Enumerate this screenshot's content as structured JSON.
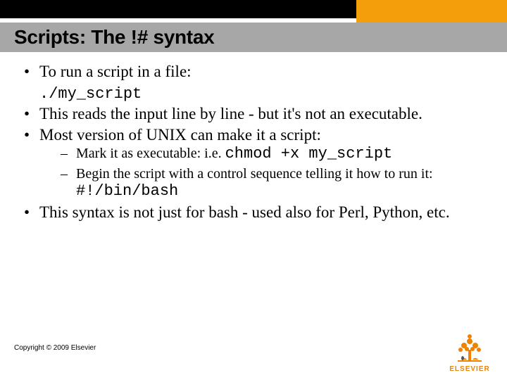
{
  "title": "Scripts: The !# syntax",
  "bullet1": "To run a script in a file:",
  "code1": "./my_script",
  "bullet2": "This reads the input line by line - but it's not an executable.",
  "bullet3": "Most version of UNIX can make it a script:",
  "sub1_pre": "Mark it as executable: i.e. ",
  "sub1_code": "chmod +x my_script",
  "sub2_pre": "Begin the script with a control sequence telling it how to run it: ",
  "sub2_code": "#!/bin/bash",
  "bullet4": "This syntax is not just for bash - used also for Perl, Python, etc.",
  "copyright": "Copyright © 2009 Elsevier",
  "logo_text": "ELSEVIER"
}
